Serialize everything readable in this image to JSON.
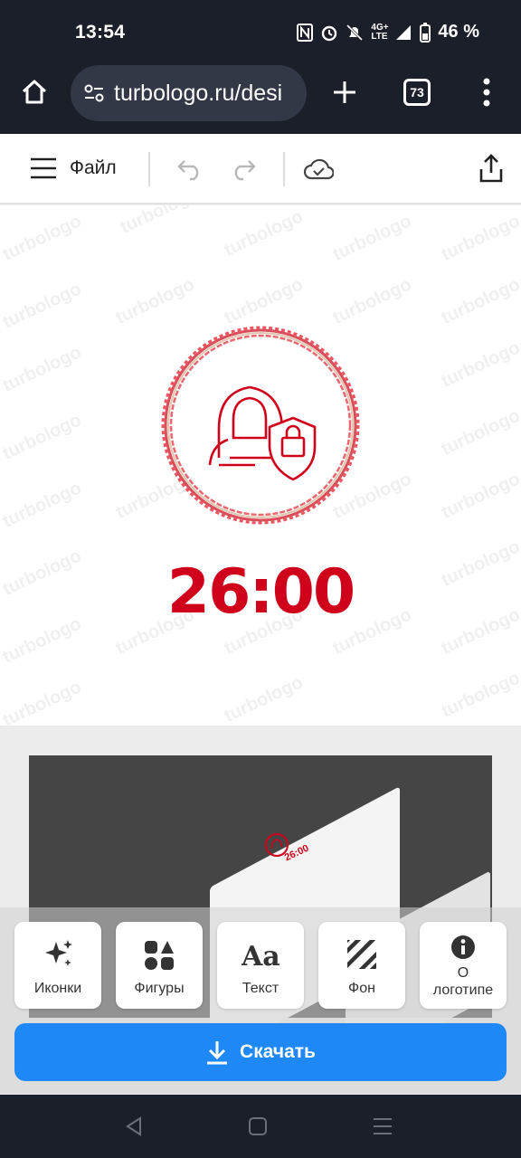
{
  "status_bar": {
    "time": "13:54",
    "battery": "46 %",
    "network": "4G+ LTE"
  },
  "browser": {
    "url": "turbologo.ru/desi",
    "tab_count": "73"
  },
  "toolbar": {
    "file_label": "Файл"
  },
  "canvas": {
    "watermark": "turbologo",
    "logo_text": "26:00"
  },
  "mockup": {
    "logo_text": "26:00"
  },
  "tools": [
    {
      "label": "Иконки",
      "icon": "sparkle-icon"
    },
    {
      "label": "Фигуры",
      "icon": "shapes-icon"
    },
    {
      "label": "Текст",
      "icon": "text-icon"
    },
    {
      "label": "Фон",
      "icon": "background-icon"
    },
    {
      "label_line1": "О",
      "label_line2": "логотипе",
      "icon": "info-icon"
    }
  ],
  "download": {
    "label": "Скачать"
  },
  "colors": {
    "accent": "#d0021b",
    "button": "#1e88f6",
    "chrome": "#1b1f2a"
  }
}
